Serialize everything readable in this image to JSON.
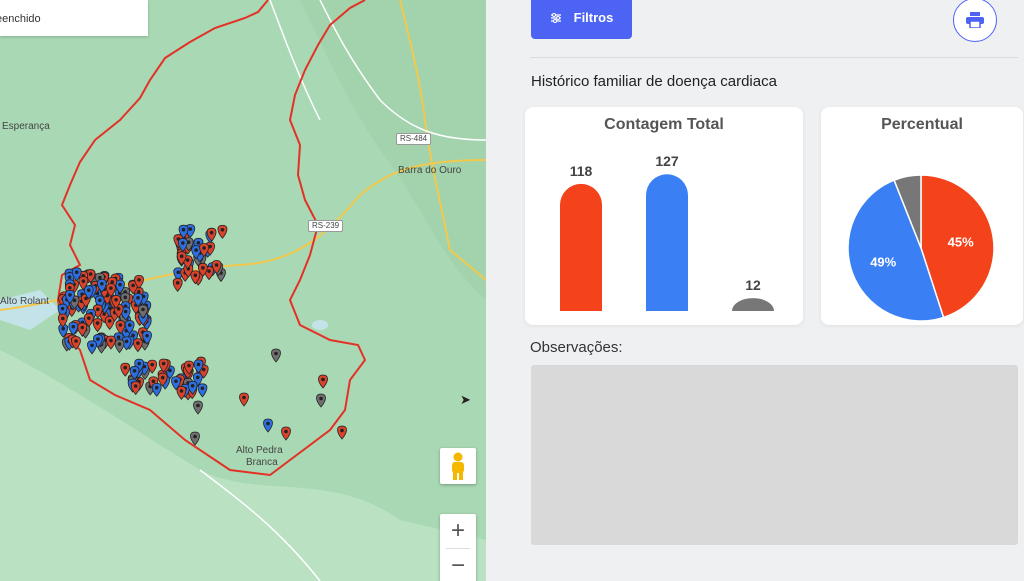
{
  "map": {
    "legend_text": "eenchido",
    "labels": {
      "esperanca": "Esperança",
      "barra_do_ouro": "Barra do Ouro",
      "alto_rolante": "Alto Rolant",
      "alto_pedra_branca_1": "Alto Pedra",
      "alto_pedra_branca_2": "Branca"
    },
    "roads": {
      "rs484": "RS-484",
      "rs239": "RS-239"
    },
    "zoom_in": "+",
    "zoom_out": "−",
    "colors": {
      "pin_red": "#d9432c",
      "pin_blue": "#2d6fe0",
      "pin_gray": "#6f6f6f",
      "border": "#e33127",
      "road": "#f2c94c"
    }
  },
  "panel": {
    "filtros_label": "Filtros",
    "section_title": "Histórico familiar de doença cardiaca",
    "bar_card_title": "Contagem Total",
    "pie_card_title": "Percentual",
    "observacoes_label": "Observações:"
  },
  "chart_data": [
    {
      "type": "bar",
      "title": "Contagem Total",
      "categories": [
        "",
        "",
        ""
      ],
      "values": [
        118,
        127,
        12
      ],
      "colors": [
        "#f4421b",
        "#3b7ff5",
        "#777777"
      ]
    },
    {
      "type": "pie",
      "title": "Percentual",
      "slices": [
        {
          "value": 45,
          "label": "45%",
          "color": "#f4421b"
        },
        {
          "value": 49,
          "label": "49%",
          "color": "#3b7ff5"
        },
        {
          "value": 6,
          "label": "",
          "color": "#777777"
        }
      ]
    }
  ]
}
